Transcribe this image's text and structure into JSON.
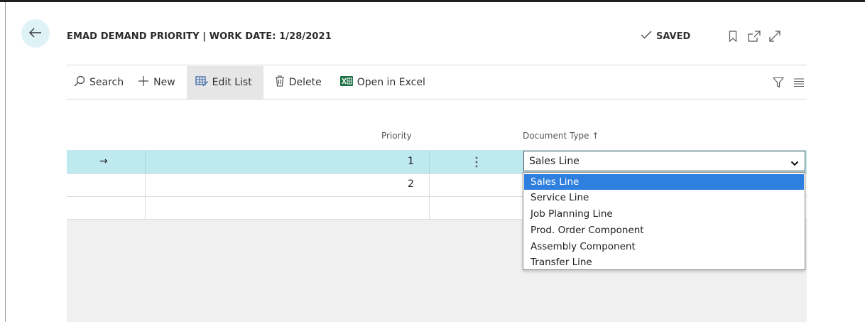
{
  "header": {
    "title": "EMAD DEMAND PRIORITY | WORK DATE: 1/28/2021",
    "saved_label": "SAVED"
  },
  "toolbar": {
    "search_label": "Search",
    "new_label": "New",
    "edit_list_label": "Edit List",
    "delete_label": "Delete",
    "excel_label": "Open in Excel"
  },
  "table": {
    "columns": {
      "priority": "Priority",
      "document_type": "Document Type",
      "sort_indicator": "↑"
    },
    "rows": [
      {
        "indicator": "→",
        "priority": "1",
        "document_type": "Sales Line"
      },
      {
        "indicator": "",
        "priority": "2",
        "document_type": ""
      },
      {
        "indicator": "",
        "priority": "",
        "document_type": ""
      }
    ]
  },
  "dropdown": {
    "selected": "Sales Line",
    "options": [
      "Sales Line",
      "Service Line",
      "Job Planning Line",
      "Prod. Order Component",
      "Assembly Component",
      "Transfer Line"
    ],
    "highlighted_index": 0
  },
  "colors": {
    "selected_row": "#bde9ef",
    "back_button_bg": "#dff2f6",
    "highlight_option": "#2f7fde",
    "excel_green": "#1e7145",
    "edit_list_icon": "#3b6aa8"
  }
}
